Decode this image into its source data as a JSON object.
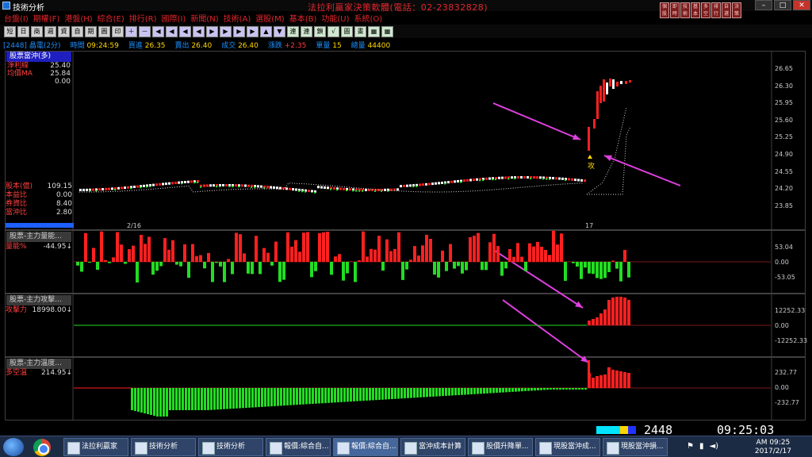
{
  "window": {
    "title": "技術分析",
    "ad_title": "法拉利贏家決策軟體(電話：02-23832828)"
  },
  "menu": [
    "台盤(I)",
    "期權(F)",
    "港盤(H)",
    "綜合(E)",
    "排行(R)",
    "國際(I)",
    "新聞(N)",
    "技術(A)",
    "選股(M)",
    "基本(B)",
    "功能(U)",
    "系統(O)"
  ],
  "toolbar": [
    "短",
    "日",
    "商",
    "週",
    "資",
    "自",
    "期",
    "圓",
    "印",
    "＋",
    "－",
    "◀",
    "◀",
    "◀",
    "◀",
    "▶",
    "▶",
    "▶",
    "▶",
    "▲",
    "▼",
    "連",
    "連",
    "鎖",
    "√",
    "圖",
    "畫",
    "▦",
    "▦"
  ],
  "quick_icons": [
    "個股",
    "即時",
    "技術",
    "基本",
    "多空",
    "排行",
    "自選",
    "決策"
  ],
  "info": {
    "code": "[2448]",
    "name": "晶電(2分)",
    "time_label": "時間",
    "time": "09:24:59",
    "bid_label": "買進",
    "bid": "26.35",
    "ask_label": "賣出",
    "ask": "26.40",
    "last_label": "成交",
    "last": "26.40",
    "chg_label": "漲跌",
    "chg": "+2.35",
    "vol_label": "單量",
    "vol": "15",
    "total_label": "總量",
    "total": "44400"
  },
  "panel1": {
    "title": "股票當沖(多)",
    "labels": [
      {
        "name": "淨利線",
        "value": "25.40"
      },
      {
        "name": "均價MA",
        "value": "25.84"
      },
      {
        "name": "",
        "value": "0.00"
      }
    ],
    "stats": [
      {
        "name": "股本(億)",
        "value": "109.15"
      },
      {
        "name": "本益比",
        "value": "0.00"
      },
      {
        "name": "券資比",
        "value": "8.40"
      },
      {
        "name": "當沖比",
        "value": "2.80"
      }
    ],
    "yticks": [
      "26.65",
      "26.30",
      "25.95",
      "25.60",
      "25.25",
      "24.90",
      "24.55",
      "24.20",
      "23.85"
    ],
    "xticks": [
      "2/16",
      "17"
    ],
    "annotation": "攻"
  },
  "panel2": {
    "title": "股票-主力量能...",
    "label": "量能%",
    "value": "-44.95↓",
    "yticks": [
      "53.04",
      "0.00",
      "-53.05"
    ]
  },
  "panel3": {
    "title": "股票-主力攻擊...",
    "label": "攻擊力",
    "value": "18998.00↓",
    "yticks": [
      "12252.33",
      "0.00",
      "-12252.33"
    ]
  },
  "panel4": {
    "title": "股票-主力溫度...",
    "label": "多空溫",
    "value": "214.95↓",
    "yticks": [
      "232.77",
      "0.00",
      "-232.77"
    ]
  },
  "status": {
    "code": "2448",
    "clock": "09:25:03"
  },
  "colors": {
    "up": "#ff2020",
    "down": "#22dd22",
    "arrow": "#e040e0",
    "label_blue": "#1e90ff"
  },
  "taskbar": {
    "items": [
      "法拉利贏家",
      "技術分析",
      "技術分析",
      "報價:綜合自...",
      "報價:綜合自...",
      "當沖成本計算",
      "股價升降單...",
      "現股當沖成...",
      "現股當沖損..."
    ],
    "time": "AM 09:25",
    "date": "2017/2/17"
  }
}
